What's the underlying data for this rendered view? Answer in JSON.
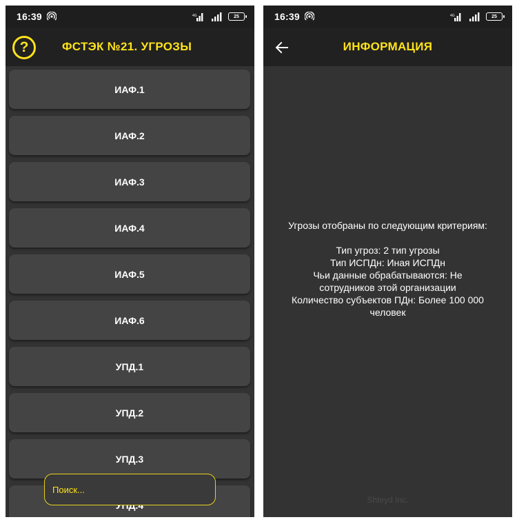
{
  "status": {
    "time": "16:39",
    "battery": "25"
  },
  "screen_list": {
    "title": "ФСТЭК №21. УГРОЗЫ",
    "help_glyph": "?",
    "items": [
      "ИАФ.1",
      "ИАФ.2",
      "ИАФ.3",
      "ИАФ.4",
      "ИАФ.5",
      "ИАФ.6",
      "УПД.1",
      "УПД.2",
      "УПД.3",
      "УПД.4"
    ],
    "search_placeholder": "Поиск..."
  },
  "screen_info": {
    "title": "ИНФОРМАЦИЯ",
    "intro": "Угрозы отобраны по следующим критериям:",
    "lines": [
      "Тип угроз: 2 тип угрозы",
      "Тип ИСПДн: Иная ИСПДн",
      "Чьи данные обрабатываются: Не",
      "сотрудников этой организации",
      "Количество субъектов ПДн: Более 100 000",
      "человек"
    ],
    "footer": "Shteyd Inc."
  },
  "colors": {
    "accent": "#ffe31a",
    "background": "#333333",
    "card": "#444444",
    "bar": "#212121"
  }
}
